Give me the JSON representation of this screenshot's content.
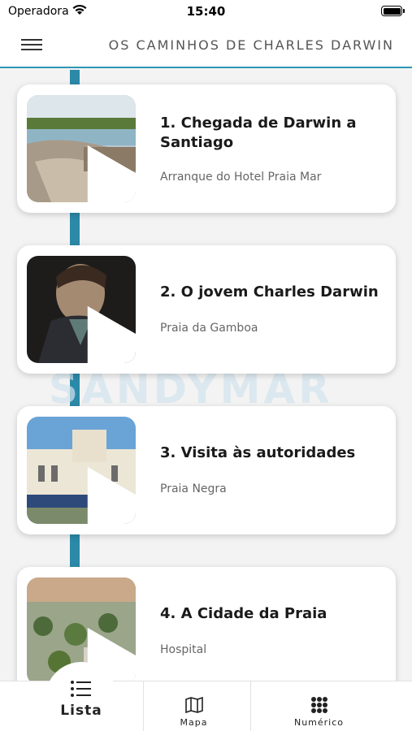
{
  "status_bar": {
    "carrier": "Operadora",
    "time": "15:40"
  },
  "header": {
    "title": "OS CAMINHOS DE CHARLES DARWIN",
    "menu_icon": "hamburger-icon"
  },
  "watermark": "SANDYMAR",
  "colors": {
    "accent": "#2b8aa8",
    "header_border": "#2d97b7",
    "background": "#f3f3f3"
  },
  "stops": [
    {
      "title": "1. Chegada de Darwin a Santiago",
      "subtitle": "Arranque do Hotel Praia Mar"
    },
    {
      "title": "2. O jovem Charles Darwin",
      "subtitle": "Praia da Gamboa"
    },
    {
      "title": "3. Visita às autoridades",
      "subtitle": "Praia Negra"
    },
    {
      "title": "4. A Cidade da Praia",
      "subtitle": "Hospital"
    }
  ],
  "bottom_nav": {
    "tabs": [
      {
        "label": "Lista",
        "icon": "list-icon",
        "active": true
      },
      {
        "label": "Mapa",
        "icon": "map-icon",
        "active": false
      },
      {
        "label": "Numérico",
        "icon": "grid-icon",
        "active": false
      }
    ]
  }
}
